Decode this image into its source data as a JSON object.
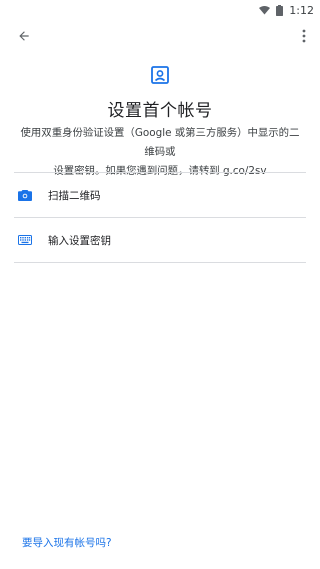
{
  "status_bar": {
    "time": "1:12"
  },
  "header": {
    "title": "设置首个帐号",
    "description_line1": "使用双重身份验证设置（Google 或第三方服务）中显示的二维码或",
    "description_line2": "设置密钥。如果您遇到问题，请转到 g.co/2sv"
  },
  "options": [
    {
      "label": "扫描二维码",
      "icon": "camera-icon"
    },
    {
      "label": "输入设置密钥",
      "icon": "keyboard-icon"
    }
  ],
  "footer": {
    "import_link": "要导入现有帐号吗?"
  },
  "colors": {
    "accent": "#1a73e8",
    "divider": "#dadce0",
    "icon": "#5f6368"
  }
}
